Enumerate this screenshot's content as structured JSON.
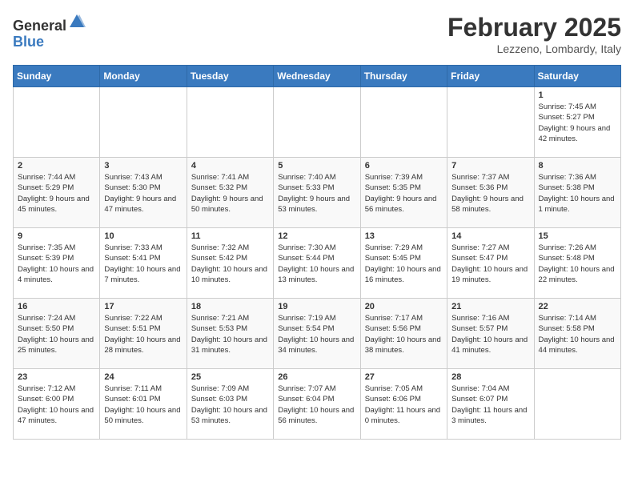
{
  "header": {
    "logo_general": "General",
    "logo_blue": "Blue",
    "month": "February 2025",
    "location": "Lezzeno, Lombardy, Italy"
  },
  "weekdays": [
    "Sunday",
    "Monday",
    "Tuesday",
    "Wednesday",
    "Thursday",
    "Friday",
    "Saturday"
  ],
  "weeks": [
    [
      {
        "day": "",
        "info": ""
      },
      {
        "day": "",
        "info": ""
      },
      {
        "day": "",
        "info": ""
      },
      {
        "day": "",
        "info": ""
      },
      {
        "day": "",
        "info": ""
      },
      {
        "day": "",
        "info": ""
      },
      {
        "day": "1",
        "info": "Sunrise: 7:45 AM\nSunset: 5:27 PM\nDaylight: 9 hours and 42 minutes."
      }
    ],
    [
      {
        "day": "2",
        "info": "Sunrise: 7:44 AM\nSunset: 5:29 PM\nDaylight: 9 hours and 45 minutes."
      },
      {
        "day": "3",
        "info": "Sunrise: 7:43 AM\nSunset: 5:30 PM\nDaylight: 9 hours and 47 minutes."
      },
      {
        "day": "4",
        "info": "Sunrise: 7:41 AM\nSunset: 5:32 PM\nDaylight: 9 hours and 50 minutes."
      },
      {
        "day": "5",
        "info": "Sunrise: 7:40 AM\nSunset: 5:33 PM\nDaylight: 9 hours and 53 minutes."
      },
      {
        "day": "6",
        "info": "Sunrise: 7:39 AM\nSunset: 5:35 PM\nDaylight: 9 hours and 56 minutes."
      },
      {
        "day": "7",
        "info": "Sunrise: 7:37 AM\nSunset: 5:36 PM\nDaylight: 9 hours and 58 minutes."
      },
      {
        "day": "8",
        "info": "Sunrise: 7:36 AM\nSunset: 5:38 PM\nDaylight: 10 hours and 1 minute."
      }
    ],
    [
      {
        "day": "9",
        "info": "Sunrise: 7:35 AM\nSunset: 5:39 PM\nDaylight: 10 hours and 4 minutes."
      },
      {
        "day": "10",
        "info": "Sunrise: 7:33 AM\nSunset: 5:41 PM\nDaylight: 10 hours and 7 minutes."
      },
      {
        "day": "11",
        "info": "Sunrise: 7:32 AM\nSunset: 5:42 PM\nDaylight: 10 hours and 10 minutes."
      },
      {
        "day": "12",
        "info": "Sunrise: 7:30 AM\nSunset: 5:44 PM\nDaylight: 10 hours and 13 minutes."
      },
      {
        "day": "13",
        "info": "Sunrise: 7:29 AM\nSunset: 5:45 PM\nDaylight: 10 hours and 16 minutes."
      },
      {
        "day": "14",
        "info": "Sunrise: 7:27 AM\nSunset: 5:47 PM\nDaylight: 10 hours and 19 minutes."
      },
      {
        "day": "15",
        "info": "Sunrise: 7:26 AM\nSunset: 5:48 PM\nDaylight: 10 hours and 22 minutes."
      }
    ],
    [
      {
        "day": "16",
        "info": "Sunrise: 7:24 AM\nSunset: 5:50 PM\nDaylight: 10 hours and 25 minutes."
      },
      {
        "day": "17",
        "info": "Sunrise: 7:22 AM\nSunset: 5:51 PM\nDaylight: 10 hours and 28 minutes."
      },
      {
        "day": "18",
        "info": "Sunrise: 7:21 AM\nSunset: 5:53 PM\nDaylight: 10 hours and 31 minutes."
      },
      {
        "day": "19",
        "info": "Sunrise: 7:19 AM\nSunset: 5:54 PM\nDaylight: 10 hours and 34 minutes."
      },
      {
        "day": "20",
        "info": "Sunrise: 7:17 AM\nSunset: 5:56 PM\nDaylight: 10 hours and 38 minutes."
      },
      {
        "day": "21",
        "info": "Sunrise: 7:16 AM\nSunset: 5:57 PM\nDaylight: 10 hours and 41 minutes."
      },
      {
        "day": "22",
        "info": "Sunrise: 7:14 AM\nSunset: 5:58 PM\nDaylight: 10 hours and 44 minutes."
      }
    ],
    [
      {
        "day": "23",
        "info": "Sunrise: 7:12 AM\nSunset: 6:00 PM\nDaylight: 10 hours and 47 minutes."
      },
      {
        "day": "24",
        "info": "Sunrise: 7:11 AM\nSunset: 6:01 PM\nDaylight: 10 hours and 50 minutes."
      },
      {
        "day": "25",
        "info": "Sunrise: 7:09 AM\nSunset: 6:03 PM\nDaylight: 10 hours and 53 minutes."
      },
      {
        "day": "26",
        "info": "Sunrise: 7:07 AM\nSunset: 6:04 PM\nDaylight: 10 hours and 56 minutes."
      },
      {
        "day": "27",
        "info": "Sunrise: 7:05 AM\nSunset: 6:06 PM\nDaylight: 11 hours and 0 minutes."
      },
      {
        "day": "28",
        "info": "Sunrise: 7:04 AM\nSunset: 6:07 PM\nDaylight: 11 hours and 3 minutes."
      },
      {
        "day": "",
        "info": ""
      }
    ]
  ]
}
